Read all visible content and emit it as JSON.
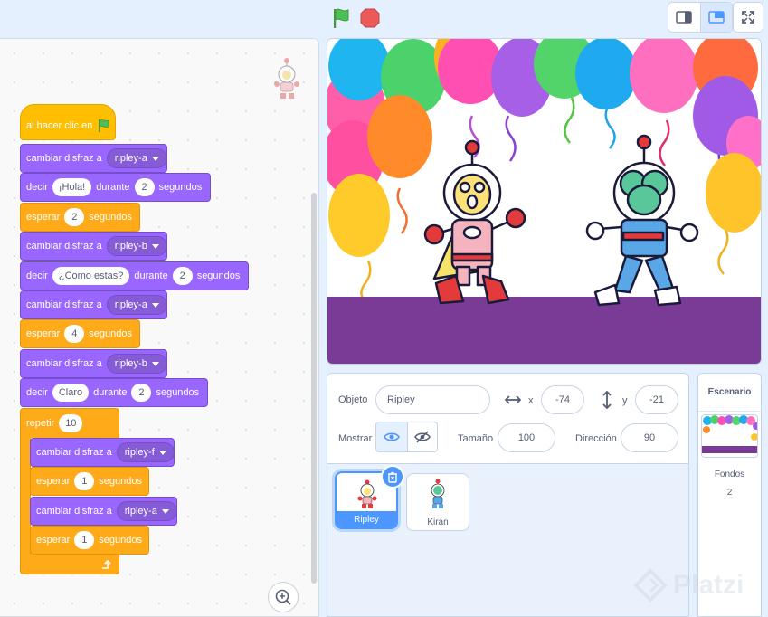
{
  "toolbar": {
    "flag_icon": "green-flag-icon",
    "stop_icon": "stop-icon",
    "layout_icons": [
      "small-stage-icon",
      "large-stage-icon",
      "fullscreen-icon"
    ]
  },
  "script": {
    "hat": {
      "label": "al hacer clic en"
    },
    "blocks": [
      {
        "kind": "looks",
        "text": "cambiar disfraz a",
        "value": "ripley-a"
      },
      {
        "kind": "looks",
        "text": "decir",
        "value": "¡Hola!",
        "text2": "durante",
        "value2": "2",
        "text3": "segundos"
      },
      {
        "kind": "control",
        "text": "esperar",
        "value": "2",
        "text2": "segundos"
      },
      {
        "kind": "looks",
        "text": "cambiar disfraz a",
        "value": "ripley-b"
      },
      {
        "kind": "looks",
        "text": "decir",
        "value": "¿Como estas?",
        "text2": "durante",
        "value2": "2",
        "text3": "segundos"
      },
      {
        "kind": "looks",
        "text": "cambiar disfraz a",
        "value": "ripley-a"
      },
      {
        "kind": "control",
        "text": "esperar",
        "value": "4",
        "text2": "segundos"
      },
      {
        "kind": "looks",
        "text": "cambiar disfraz a",
        "value": "ripley-b"
      },
      {
        "kind": "looks",
        "text": "decir",
        "value": "Claro",
        "text2": "durante",
        "value2": "2",
        "text3": "segundos"
      }
    ],
    "repeat": {
      "label": "repetir",
      "value": "10",
      "inner": [
        {
          "kind": "looks",
          "text": "cambiar disfraz a",
          "value": "ripley-f"
        },
        {
          "kind": "control",
          "text": "esperar",
          "value": "1",
          "text2": "segundos"
        },
        {
          "kind": "looks",
          "text": "cambiar disfraz a",
          "value": "ripley-a"
        },
        {
          "kind": "control",
          "text": "esperar",
          "value": "1",
          "text2": "segundos"
        }
      ]
    }
  },
  "sprite_info": {
    "object_label": "Objeto",
    "object_name": "Ripley",
    "x_label": "x",
    "x": "-74",
    "y_label": "y",
    "y": "-21",
    "show_label": "Mostrar",
    "size_label": "Tamaño",
    "size": "100",
    "direction_label": "Dirección",
    "direction": "90"
  },
  "sprites": [
    {
      "name": "Ripley",
      "selected": true
    },
    {
      "name": "Kiran",
      "selected": false
    }
  ],
  "stage_panel": {
    "title": "Escenario",
    "backdrops_label": "Fondos",
    "backdrops_count": "2"
  },
  "watermark": "Platzi",
  "colors": {
    "looks": "#9966ff",
    "control": "#ffab19",
    "events": "#ffbf00",
    "accent": "#4c97ff",
    "stage_floor": "#7a3b96"
  }
}
